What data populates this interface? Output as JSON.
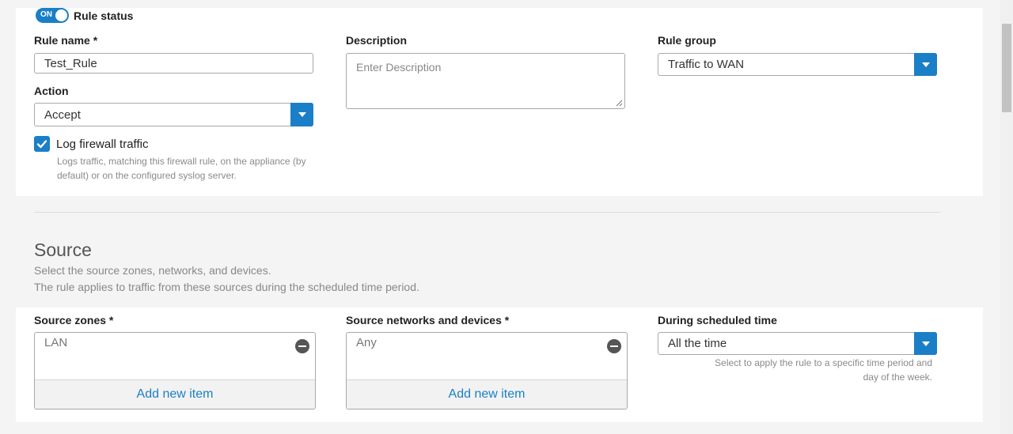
{
  "rule_status": {
    "toggle_text": "ON",
    "label": "Rule status"
  },
  "rule_name": {
    "label": "Rule name *",
    "value": "Test_Rule"
  },
  "description": {
    "label": "Description",
    "placeholder": "Enter Description"
  },
  "rule_group": {
    "label": "Rule group",
    "value": "Traffic to WAN"
  },
  "action": {
    "label": "Action",
    "value": "Accept"
  },
  "log_traffic": {
    "label": "Log firewall traffic",
    "checked": true,
    "hint_line1": "Logs traffic, matching this firewall rule, on the appliance (by",
    "hint_line2": "default) or on the configured syslog server."
  },
  "source": {
    "title": "Source",
    "desc_line1": "Select the source zones, networks, and devices.",
    "desc_line2": "The rule applies to traffic from these sources during the scheduled time period.",
    "zones": {
      "label": "Source zones *",
      "item": "LAN",
      "add_label": "Add new item"
    },
    "networks": {
      "label": "Source networks and devices *",
      "item": "Any",
      "add_label": "Add new item"
    },
    "schedule": {
      "label": "During scheduled time",
      "value": "All the time",
      "hint_line1": "Select to apply the rule to a specific time period and",
      "hint_line2": "day of the week."
    }
  },
  "colors": {
    "accent": "#1a7fc6",
    "background": "#f4f4f4",
    "card": "#ffffff"
  }
}
